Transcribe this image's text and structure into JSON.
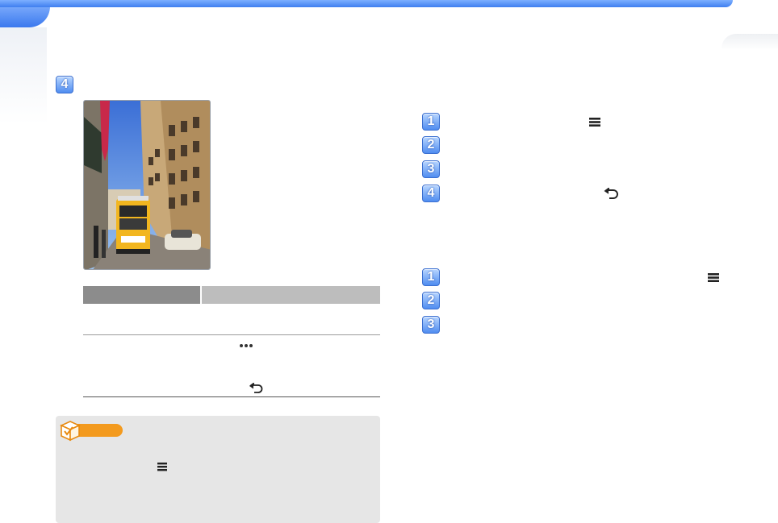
{
  "header": {
    "bar_color": "#3f7ff0"
  },
  "left_section": {
    "step_badge": "4",
    "photo": {
      "subject": "yellow-tram-street-photo"
    },
    "table": {
      "icons": [
        "more-dots-icon",
        "back-arrow-icon"
      ]
    },
    "note": {
      "icon": "note-check-icon",
      "accent_color": "#f39a1e",
      "inline_icon": "menu-icon"
    }
  },
  "right_section": {
    "group1_steps": [
      "1",
      "2",
      "3",
      "4"
    ],
    "group1_icons": [
      "menu-icon",
      "back-arrow-icon"
    ],
    "group2_steps": [
      "1",
      "2",
      "3"
    ],
    "group2_icons": [
      "menu-icon"
    ]
  }
}
